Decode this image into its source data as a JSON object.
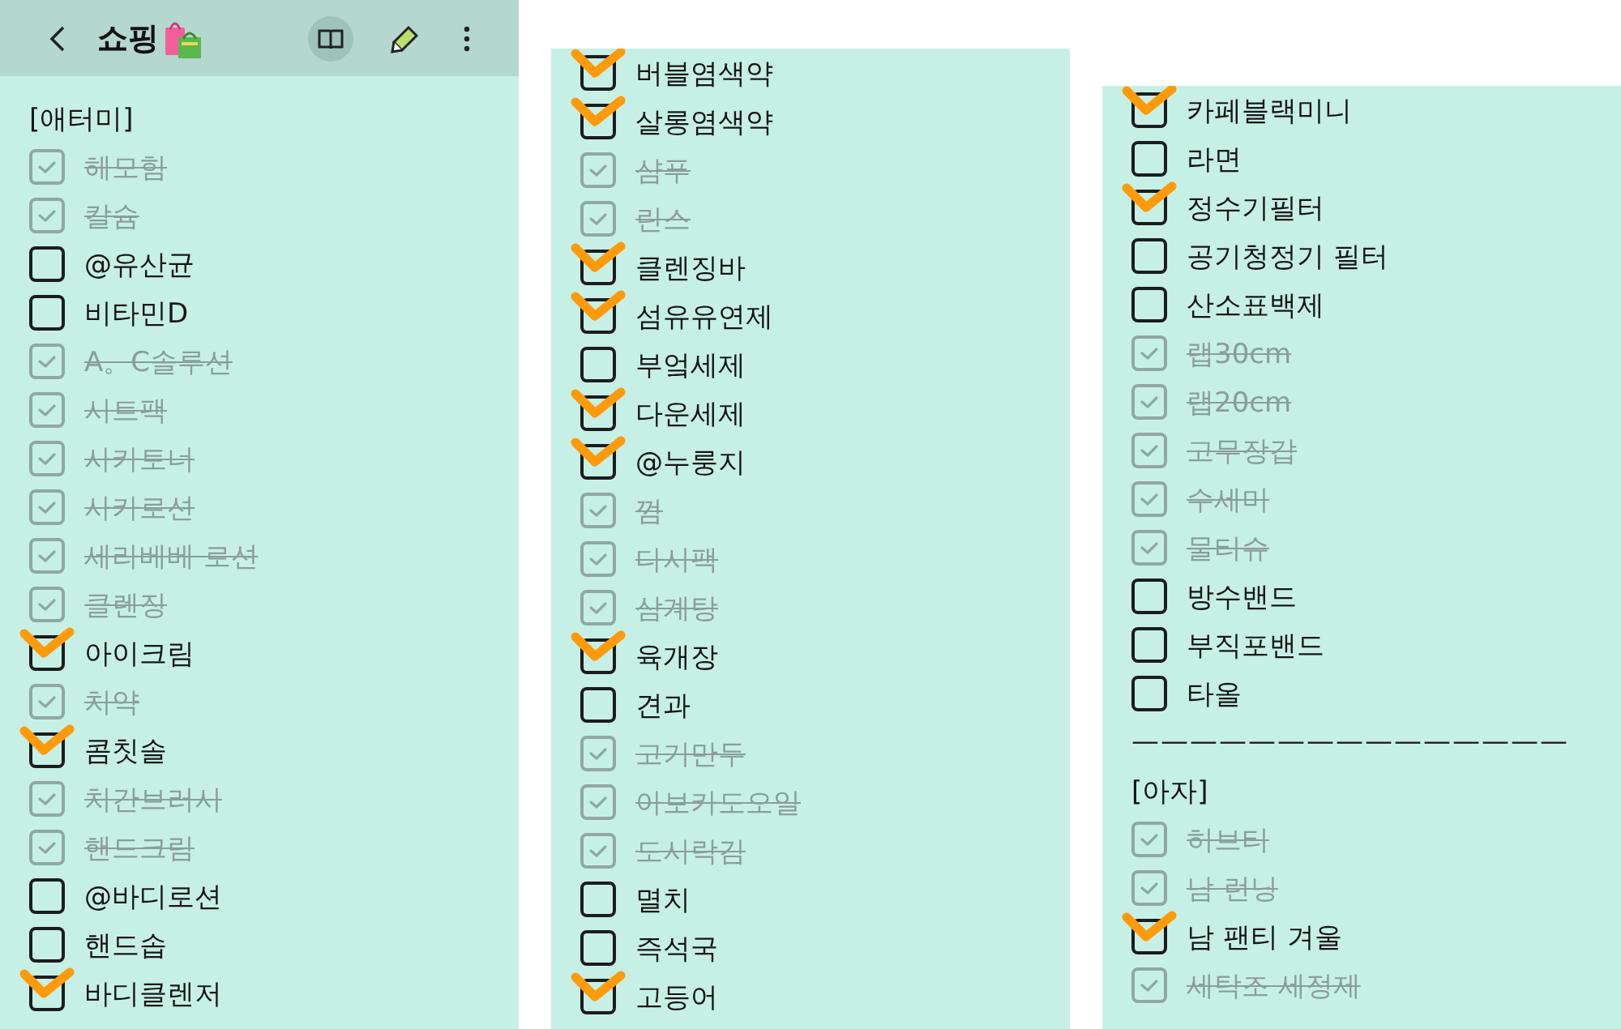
{
  "header": {
    "title": "쇼핑",
    "reading_mode_selected": true
  },
  "panels": [
    {
      "lines": [
        {
          "kind": "heading",
          "text": "[애터미]"
        },
        {
          "kind": "item",
          "text": "헤모힘",
          "checked": true,
          "struck_through": true
        },
        {
          "kind": "item",
          "text": "칼슘",
          "checked": true,
          "struck_through": true
        },
        {
          "kind": "item",
          "text": "@유산균",
          "checked": false,
          "struck_through": false
        },
        {
          "kind": "item",
          "text": "비타민D",
          "checked": false,
          "struck_through": false
        },
        {
          "kind": "item",
          "text": "A。C솔루션",
          "checked": true,
          "struck_through": true
        },
        {
          "kind": "item",
          "text": "시트팩",
          "checked": true,
          "struck_through": true
        },
        {
          "kind": "item",
          "text": "사카토너",
          "checked": true,
          "struck_through": true
        },
        {
          "kind": "item",
          "text": "사카로션",
          "checked": true,
          "struck_through": true
        },
        {
          "kind": "item",
          "text": "세라베베 로션",
          "checked": true,
          "struck_through": true
        },
        {
          "kind": "item",
          "text": "클렌징",
          "checked": true,
          "struck_through": true
        },
        {
          "kind": "item",
          "text": "아이크림",
          "checked": true,
          "struck_through": false
        },
        {
          "kind": "item",
          "text": "치약",
          "checked": true,
          "struck_through": true
        },
        {
          "kind": "item",
          "text": "콤칫솔",
          "checked": true,
          "struck_through": false
        },
        {
          "kind": "item",
          "text": "치간브러시",
          "checked": true,
          "struck_through": true
        },
        {
          "kind": "item",
          "text": "핸드크림",
          "checked": true,
          "struck_through": true
        },
        {
          "kind": "item",
          "text": "@바디로션",
          "checked": false,
          "struck_through": false
        },
        {
          "kind": "item",
          "text": "핸드솝",
          "checked": false,
          "struck_through": false
        },
        {
          "kind": "item",
          "text": "바디클렌저",
          "checked": true,
          "struck_through": false
        }
      ]
    },
    {
      "lines": [
        {
          "kind": "item",
          "text": "버블염색약",
          "checked": true,
          "struck_through": false
        },
        {
          "kind": "item",
          "text": "살롱염색약",
          "checked": true,
          "struck_through": false
        },
        {
          "kind": "item",
          "text": "샴푸",
          "checked": true,
          "struck_through": true
        },
        {
          "kind": "item",
          "text": "린스",
          "checked": true,
          "struck_through": true
        },
        {
          "kind": "item",
          "text": "클렌징바",
          "checked": true,
          "struck_through": false
        },
        {
          "kind": "item",
          "text": "섬유유연제",
          "checked": true,
          "struck_through": false
        },
        {
          "kind": "item",
          "text": "부엌세제",
          "checked": false,
          "struck_through": false
        },
        {
          "kind": "item",
          "text": "다운세제",
          "checked": true,
          "struck_through": false
        },
        {
          "kind": "item",
          "text": "@누룽지",
          "checked": true,
          "struck_through": false
        },
        {
          "kind": "item",
          "text": "껌",
          "checked": true,
          "struck_through": true
        },
        {
          "kind": "item",
          "text": "다시팩",
          "checked": true,
          "struck_through": true
        },
        {
          "kind": "item",
          "text": "삼계탕",
          "checked": true,
          "struck_through": true
        },
        {
          "kind": "item",
          "text": "육개장",
          "checked": true,
          "struck_through": false
        },
        {
          "kind": "item",
          "text": "견과",
          "checked": false,
          "struck_through": false
        },
        {
          "kind": "item",
          "text": "고기만두",
          "checked": true,
          "struck_through": true
        },
        {
          "kind": "item",
          "text": "아보카도오일",
          "checked": true,
          "struck_through": true
        },
        {
          "kind": "item",
          "text": "도시락김",
          "checked": true,
          "struck_through": true
        },
        {
          "kind": "item",
          "text": "멸치",
          "checked": false,
          "struck_through": false
        },
        {
          "kind": "item",
          "text": "즉석국",
          "checked": false,
          "struck_through": false
        },
        {
          "kind": "item",
          "text": "고등어",
          "checked": true,
          "struck_through": false
        }
      ]
    },
    {
      "lines": [
        {
          "kind": "item",
          "text": "카페블랙미니",
          "checked": true,
          "struck_through": false
        },
        {
          "kind": "item",
          "text": "라면",
          "checked": false,
          "struck_through": false
        },
        {
          "kind": "item",
          "text": "정수기필터",
          "checked": true,
          "struck_through": false
        },
        {
          "kind": "item",
          "text": "공기청정기 필터",
          "checked": false,
          "struck_through": false
        },
        {
          "kind": "item",
          "text": "산소표백제",
          "checked": false,
          "struck_through": false
        },
        {
          "kind": "item",
          "text": "랩30cm",
          "checked": true,
          "struck_through": true
        },
        {
          "kind": "item",
          "text": "랩20cm",
          "checked": true,
          "struck_through": true
        },
        {
          "kind": "item",
          "text": "고무장갑",
          "checked": true,
          "struck_through": true
        },
        {
          "kind": "item",
          "text": "수세미",
          "checked": true,
          "struck_through": true
        },
        {
          "kind": "item",
          "text": "물티슈",
          "checked": true,
          "struck_through": true
        },
        {
          "kind": "item",
          "text": "방수밴드",
          "checked": false,
          "struck_through": false
        },
        {
          "kind": "item",
          "text": "부직포밴드",
          "checked": false,
          "struck_through": false
        },
        {
          "kind": "item",
          "text": "타올",
          "checked": false,
          "struck_through": false
        },
        {
          "kind": "rule",
          "text": "———————————————"
        },
        {
          "kind": "heading",
          "text": "[아자]"
        },
        {
          "kind": "item",
          "text": "허브티",
          "checked": true,
          "struck_through": true
        },
        {
          "kind": "item",
          "text": "남 런닝",
          "checked": true,
          "struck_through": true
        },
        {
          "kind": "item",
          "text": "남 팬티 겨울",
          "checked": true,
          "struck_through": false
        },
        {
          "kind": "item",
          "text": "세탁조 세정제",
          "checked": true,
          "struck_through": true
        }
      ]
    }
  ]
}
